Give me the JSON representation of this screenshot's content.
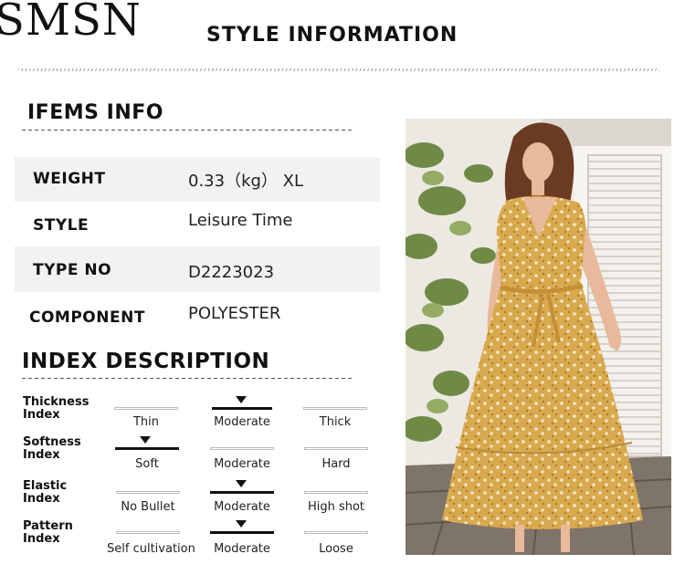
{
  "brand": "SMSN",
  "page_title": "STYLE INFORMATION",
  "items_section": {
    "title": "IFEMS INFO",
    "rows": [
      {
        "label": "WEIGHT",
        "value": "0.33（kg） XL"
      },
      {
        "label": "STYLE",
        "value": "Leisure Time"
      },
      {
        "label": "TYPE NO",
        "value": "D2223023"
      },
      {
        "label": "COMPONENT",
        "value": "POLYESTER"
      }
    ]
  },
  "index_section": {
    "title": "INDEX DESCRIPTION",
    "rows": [
      {
        "label_line1": "Thickness",
        "label_line2": "Index",
        "options": [
          "Thin",
          "Moderate",
          "Thick"
        ],
        "selected": 1
      },
      {
        "label_line1": "Softness",
        "label_line2": "Index",
        "options": [
          "Soft",
          "Moderate",
          "Hard"
        ],
        "selected": 0
      },
      {
        "label_line1": "Elastic",
        "label_line2": "Index",
        "options": [
          "No Bullet",
          "Moderate",
          "High shot"
        ],
        "selected": 1
      },
      {
        "label_line1": "Pattern",
        "label_line2": "Index",
        "options": [
          "Self cultivation",
          "Moderate",
          "Loose"
        ],
        "selected": 1
      }
    ]
  },
  "photo": {
    "subject": "model-in-yellow-floral-dress",
    "colors": {
      "dress": "#d9a94e",
      "pattern": "#f6ead0",
      "wall": "#ece8e2",
      "floor": "#7e746a",
      "leaves": "#6f8a45",
      "hair": "#6b3a22",
      "skin": "#e8b99a"
    }
  }
}
